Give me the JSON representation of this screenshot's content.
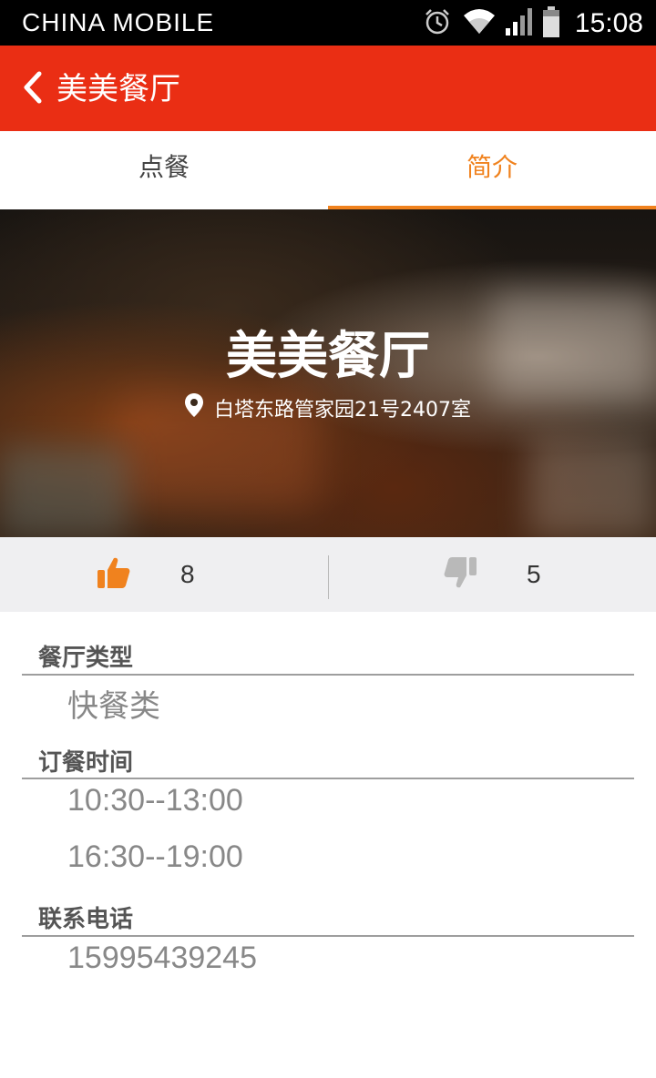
{
  "status_bar": {
    "carrier": "CHINA  MOBILE",
    "time": "15:08",
    "icons": [
      "alarm-icon",
      "wifi-icon",
      "signal-icon",
      "battery-icon"
    ]
  },
  "title_bar": {
    "title": "美美餐厅",
    "back_icon": "chevron-left-icon",
    "color": "#ea2e14"
  },
  "tabs": [
    {
      "label": "点餐",
      "active": false
    },
    {
      "label": "简介",
      "active": true
    }
  ],
  "accent_color": "#f0821e",
  "hero": {
    "name": "美美餐厅",
    "address": "白塔东路管家园21号2407室",
    "address_icon": "location-pin-icon"
  },
  "votes": {
    "up": {
      "icon": "thumbs-up-icon",
      "count": "8"
    },
    "down": {
      "icon": "thumbs-down-icon",
      "count": "5"
    }
  },
  "info": {
    "type": {
      "label": "餐厅类型",
      "value": "快餐类"
    },
    "hours": {
      "label": "订餐时间",
      "values": [
        "10:30--13:00",
        "16:30--19:00"
      ]
    },
    "phone": {
      "label": "联系电话",
      "value": "15995439245"
    }
  }
}
